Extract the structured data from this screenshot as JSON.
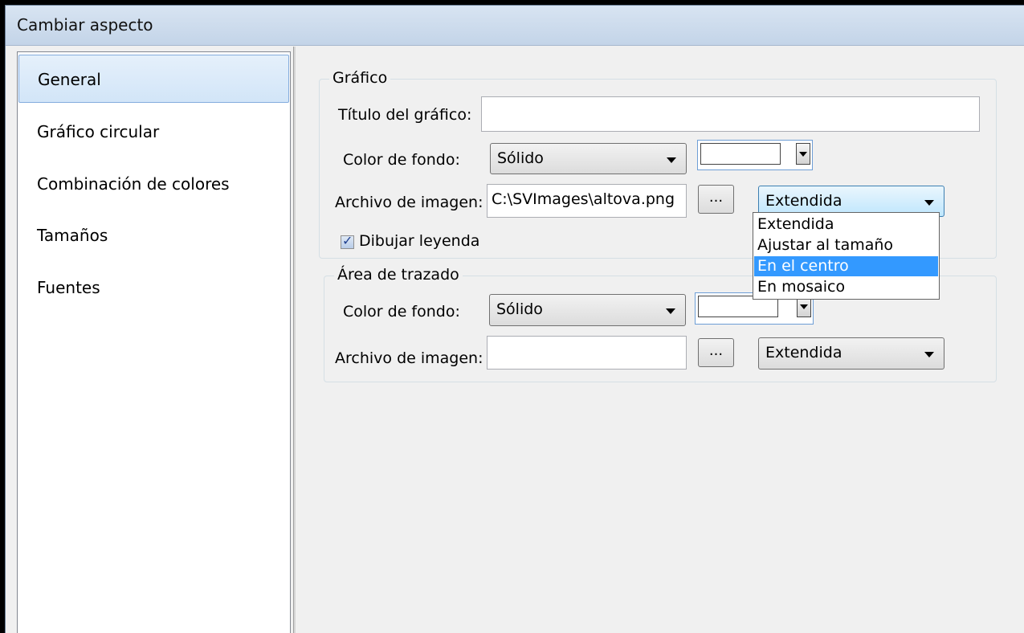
{
  "window": {
    "title": "Cambiar aspecto"
  },
  "sidebar": {
    "items": [
      {
        "label": "General",
        "selected": true
      },
      {
        "label": "Gráfico circular"
      },
      {
        "label": "Combinación de colores"
      },
      {
        "label": "Tamaños"
      },
      {
        "label": "Fuentes"
      }
    ]
  },
  "chart_group": {
    "label": "Gráfico",
    "title_label": "Título del gráfico:",
    "title_value": "",
    "bg_label": "Color de fondo:",
    "bg_value": "Sólido",
    "image_label": "Archivo de imagen:",
    "image_value": "C:\\SVImages\\altova.png",
    "browse_label": "...",
    "image_mode_value": "Extendida",
    "legend_label": "Dibujar leyenda",
    "legend_checked": true
  },
  "image_mode_dropdown": {
    "options": [
      "Extendida",
      "Ajustar al tamaño",
      "En el centro",
      "En mosaico"
    ],
    "highlighted": "En el centro"
  },
  "plot_group": {
    "label": "Área de trazado",
    "bg_label": "Color de fondo:",
    "bg_value": "Sólido",
    "image_label": "Archivo de imagen:",
    "image_value": "",
    "browse_label": "...",
    "image_mode_value": "Extendida"
  },
  "colors": {
    "selection": "#3399ff",
    "sidebar_selected": "#d2e5f8"
  }
}
